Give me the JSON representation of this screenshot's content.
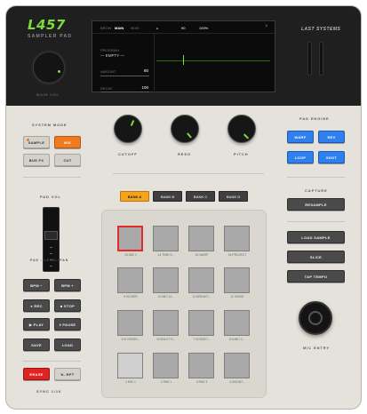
{
  "header": {
    "logo": "L457",
    "subtitle": "SAMPLER PAD",
    "main_vol_label": "MAIN VOL",
    "brand": "LAST SYSTEMS"
  },
  "screen": {
    "tabs": [
      "BROW",
      "MAIN",
      "MIXE"
    ],
    "active_tab": "MAIN",
    "warning": "▲",
    "bpm_value": "90",
    "percent_value": "100%",
    "close": "×",
    "program_label": "PROGRAM",
    "program_value": "— EMPTY —",
    "param1_label": "AMOUNT",
    "param1_value": "80",
    "param2_label": "DECAY",
    "param2_value": "100"
  },
  "left": {
    "system_mode_label": "SYSTEM MODE",
    "sample_btn": "SAMPLE",
    "mix_btn": "MIX",
    "bus_fx_btn": "BUS FX",
    "cut_btn": "CUT",
    "pad_vol_label": "PAD VOL",
    "pad_level_label": "PAD : LEVEL/PAN",
    "bpm_minus": "BPM −",
    "bpm_plus": "BPM +",
    "rec": "● REC",
    "stop": "■ STOP",
    "play": "▶ PLAY",
    "pause": "‖ PAUSE",
    "save": "SAVE",
    "load": "LOAD",
    "erase": "ERASE",
    "nrpt": "N. RPT",
    "sync_label": "SYNC 1/16"
  },
  "knobs": {
    "cutoff": "CUTOFF",
    "reso": "RESO",
    "pitch": "PITCH"
  },
  "banks": {
    "items": [
      "BANK A",
      "BANK B",
      "BANK C",
      "BANK D"
    ],
    "active": 0
  },
  "pads": {
    "labels": [
      "13 MIC 1",
      "14 TIME S...",
      "15 WARP",
      "16 PROJECT",
      "9 KICKER",
      "10 MIC 10...",
      "11 BREAKT...",
      "12 NOISE",
      "5 B CRASH...",
      "6 ROLLIT S...",
      "7 SCRATC...",
      "8 A MIC C...",
      "1 MIC 1",
      "2 PAD 1",
      "3 PAD 3",
      "4 SOUNT..."
    ],
    "selected": 0,
    "light": 12
  },
  "right": {
    "pad_engine_label": "PAD ENGINE",
    "warp": "WARP",
    "rev": "REV",
    "loop": "LOOP",
    "shot": "SHOT",
    "capture_label": "CAPTURE",
    "resample": "RESAMPLE",
    "load_sample": "LOAD SAMPLE",
    "slice": "SLICE",
    "tap_tempo": "TAP TEMPO",
    "big_knob_label": "MIC ENTRY"
  },
  "colors": {
    "accent_green": "#7ddc3c",
    "orange": "#f07a1f",
    "red": "#df2323",
    "blue": "#2e80ee",
    "bank_active": "#f5a21c"
  }
}
